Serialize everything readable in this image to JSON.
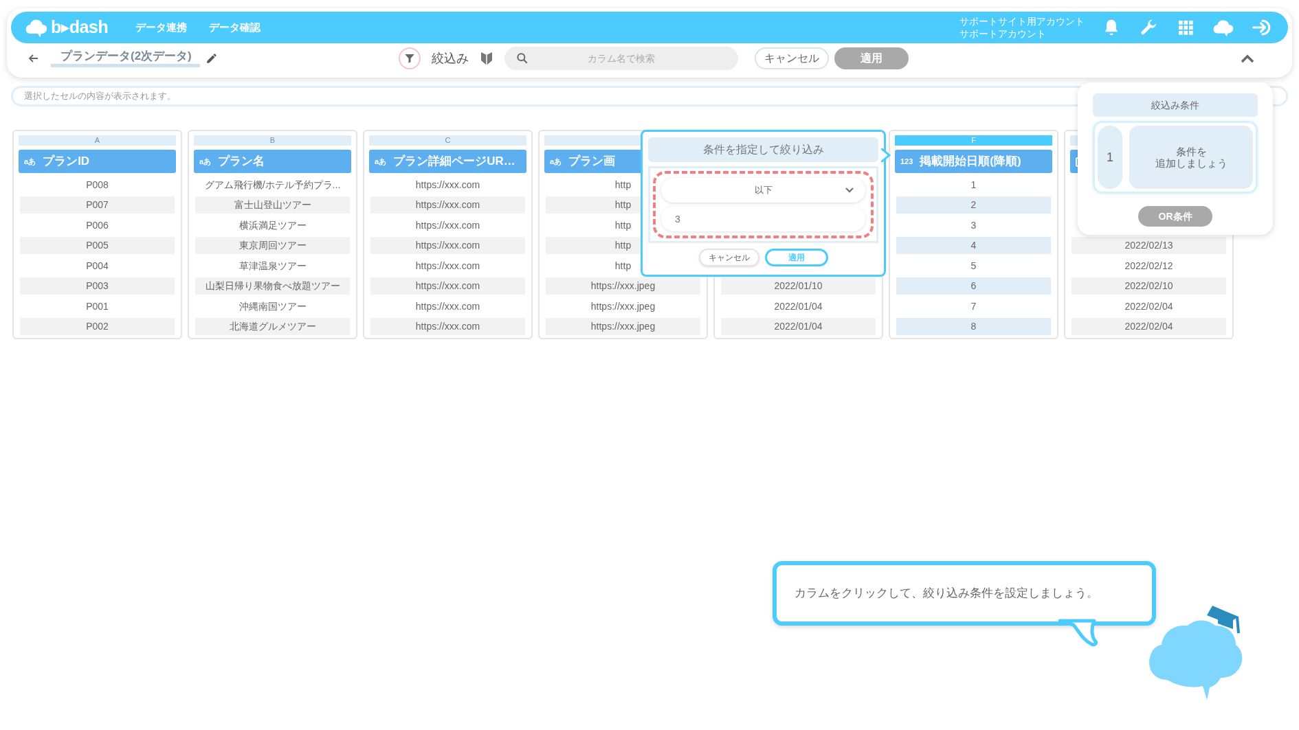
{
  "header": {
    "logo": "b▸dash",
    "nav": [
      {
        "label": "データ連携"
      },
      {
        "label": "データ確認"
      }
    ],
    "account": [
      "サポートサイト用アカウント",
      "サポートアカウント"
    ]
  },
  "toolbar": {
    "title": "プランデータ(2次データ)",
    "filter_label": "絞込み",
    "search": {
      "placeholder": "カラム名で検索"
    },
    "cancel": "キャンセル",
    "apply": {
      "label": "適用",
      "disabled": true
    }
  },
  "cell_bar": {
    "placeholder": "選択したセルの内容が表示されます。"
  },
  "columns": [
    {
      "letter": "A",
      "kind": "label",
      "type_label": "aあ",
      "header": "プランID",
      "selected": false,
      "cells": [
        "P008",
        "P007",
        "P006",
        "P005",
        "P004",
        "P003",
        "P001",
        "P002"
      ]
    },
    {
      "letter": "B",
      "kind": "label",
      "type_label": "aあ",
      "header": "プラン名",
      "selected": false,
      "cells": [
        "グアム飛行機/ホテル予約プラ...",
        "富士山登山ツアー",
        "横浜満足ツアー",
        "東京周回ツアー",
        "草津温泉ツアー",
        "山梨日帰り果物食べ放題ツアー",
        "沖縄南国ツアー",
        "北海道グルメツアー"
      ]
    },
    {
      "letter": "C",
      "kind": "label",
      "type_label": "aあ",
      "header": "プラン詳細ページUR…",
      "selected": false,
      "cells": [
        "https://xxx.com",
        "https://xxx.com",
        "https://xxx.com",
        "https://xxx.com",
        "https://xxx.com",
        "https://xxx.com",
        "https://xxx.com",
        "https://xxx.com"
      ]
    },
    {
      "kind": "label",
      "type_label": "aあ",
      "header": "プラン画",
      "selected": false,
      "cells": [
        "http",
        "http",
        "http",
        "http",
        "http",
        "https://xxx.jpeg",
        "https://xxx.jpeg",
        "https://xxx.jpeg"
      ]
    },
    {
      "selected": false,
      "cells": [
        "2022/01/10",
        "2022/01/04",
        "2022/01/04"
      ]
    },
    {
      "letter": "F",
      "kind": "label",
      "type_label": "123",
      "header": "掲載開始日順(降順)",
      "selected": true,
      "cells": [
        "1",
        "2",
        "3",
        "4",
        "5",
        "6",
        "7",
        "8"
      ]
    },
    {
      "kind": "calendar",
      "selected": false,
      "cells": [
        "2022/02/13",
        "2022/02/12",
        "2022/02/10",
        "2022/02/04",
        "2022/02/04"
      ]
    }
  ],
  "filter_popup": {
    "title": "条件を指定して絞り込み",
    "operator": "以下",
    "value": "3",
    "cancel": "キャンセル",
    "apply": "適用"
  },
  "conditions_panel": {
    "title": "絞込み条件",
    "groups": [
      {
        "number": "1",
        "prompt": [
          "条件を",
          "追加しましょう"
        ]
      }
    ],
    "or_button": {
      "label": "OR条件",
      "disabled": true
    }
  },
  "hint": "カラムをクリックして、絞り込み条件を設定しましょう。"
}
